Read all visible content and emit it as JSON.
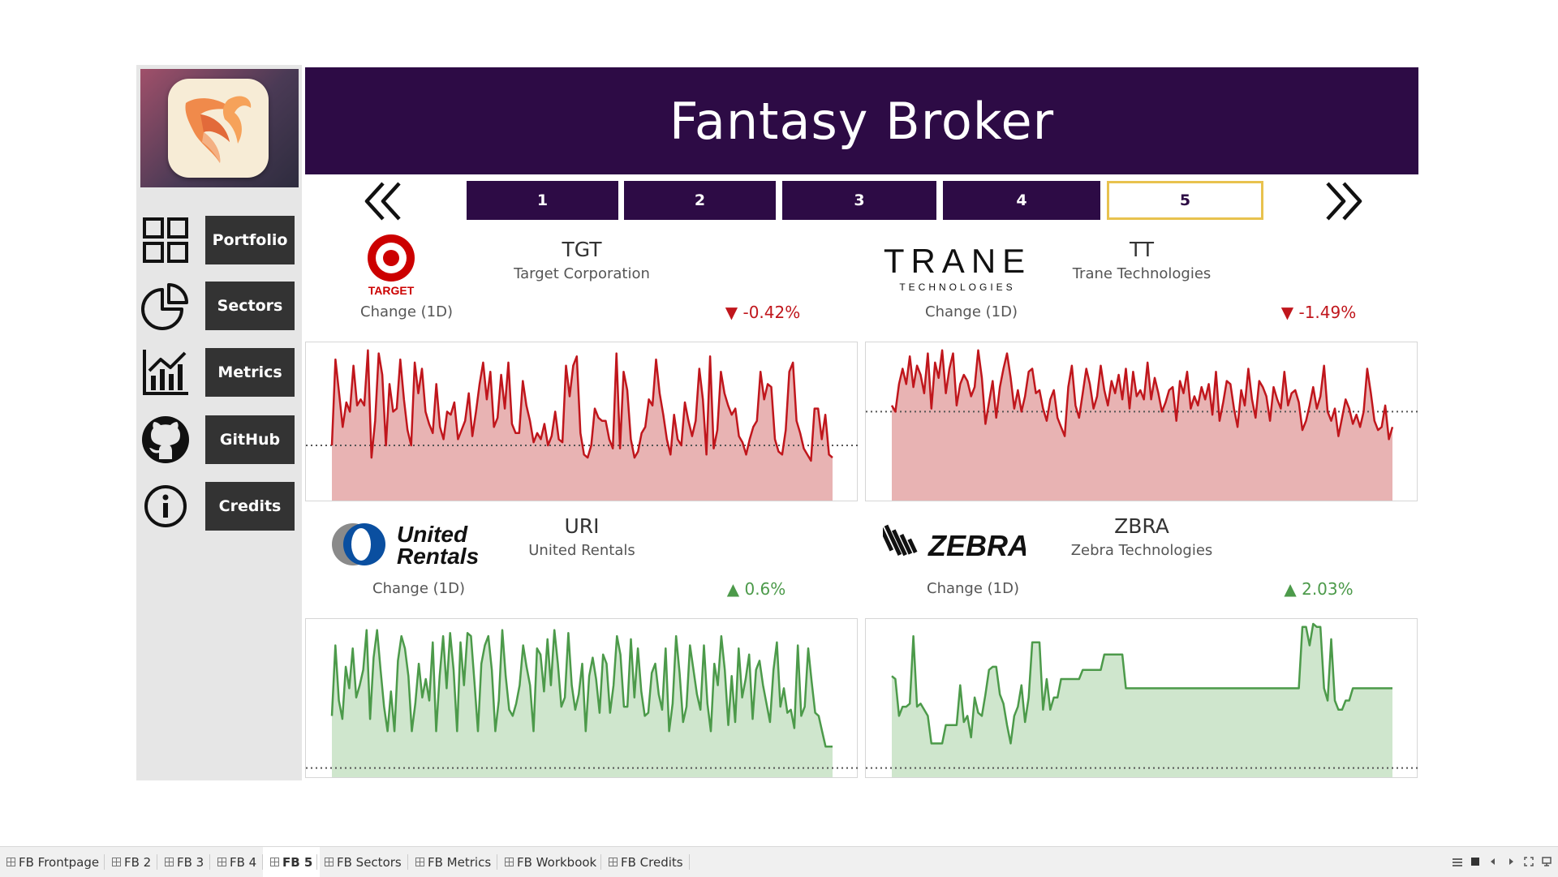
{
  "app": {
    "title": "Fantasy Broker"
  },
  "sidebar": {
    "items": [
      {
        "label": "Portfolio",
        "icon": "grid-icon"
      },
      {
        "label": "Sectors",
        "icon": "pie-chart-icon"
      },
      {
        "label": "Metrics",
        "icon": "bar-chart-icon"
      },
      {
        "label": "GitHub",
        "icon": "github-icon"
      },
      {
        "label": "Credits",
        "icon": "info-icon"
      }
    ]
  },
  "pagination": {
    "pages": [
      "1",
      "2",
      "3",
      "4",
      "5"
    ],
    "active": "5",
    "prev_icon": "double-chevron-left-icon",
    "next_icon": "double-chevron-right-icon"
  },
  "stocks": [
    {
      "ticker": "TGT",
      "company": "Target Corporation",
      "change_label": "Change (1D)",
      "change": "-0.42%",
      "direction": "down",
      "arrow": "▼",
      "logo_text": "TARGET",
      "chart_data": {
        "type": "area",
        "color": "#c0161c",
        "fill": "#e8b3b3",
        "baseline": 36,
        "values": [
          36,
          92,
          70,
          48,
          64,
          58,
          88,
          62,
          66,
          62,
          98,
          28,
          52,
          96,
          82,
          36,
          76,
          58,
          60,
          92,
          66,
          46,
          36,
          90,
          70,
          86,
          58,
          50,
          44,
          76,
          48,
          40,
          58,
          56,
          64,
          40,
          46,
          52,
          70,
          42,
          58,
          76,
          90,
          66,
          84,
          48,
          54,
          82,
          60,
          90,
          50,
          44,
          44,
          78,
          62,
          52,
          38,
          44,
          40,
          50,
          36,
          42,
          58,
          40,
          38,
          88,
          68,
          88,
          94,
          44,
          30,
          28,
          36,
          60,
          54,
          52,
          52,
          40,
          34,
          96,
          34,
          84,
          72,
          40,
          28,
          32,
          44,
          48,
          66,
          62,
          92,
          70,
          56,
          40,
          30,
          56,
          40,
          36,
          64,
          52,
          42,
          52,
          86,
          66,
          30,
          94,
          34,
          46,
          84,
          70,
          62,
          56,
          60,
          42,
          38,
          30,
          40,
          48,
          52,
          84,
          66,
          76,
          74,
          40,
          32,
          30,
          46,
          84,
          90,
          52,
          44,
          34,
          30,
          26,
          60,
          60,
          40,
          56,
          30,
          28
        ]
      }
    },
    {
      "ticker": "TT",
      "company": "Trane Technologies",
      "change_label": "Change (1D)",
      "change": "-1.49%",
      "direction": "down",
      "arrow": "▼",
      "logo_text": "TRANE",
      "logo_sub": "TECHNOLOGIES",
      "chart_data": {
        "type": "area",
        "color": "#c0161c",
        "fill": "#e8b3b3",
        "baseline": 58,
        "values": [
          62,
          58,
          76,
          86,
          76,
          94,
          74,
          88,
          82,
          70,
          96,
          60,
          90,
          80,
          98,
          70,
          86,
          96,
          62,
          76,
          82,
          78,
          68,
          74,
          98,
          80,
          50,
          64,
          78,
          54,
          74,
          86,
          96,
          80,
          60,
          72,
          58,
          68,
          84,
          86,
          70,
          72,
          60,
          52,
          66,
          72,
          54,
          48,
          42,
          74,
          88,
          62,
          54,
          70,
          86,
          76,
          60,
          68,
          88,
          72,
          62,
          78,
          70,
          82,
          66,
          86,
          60,
          84,
          68,
          72,
          66,
          90,
          66,
          80,
          70,
          58,
          64,
          72,
          74,
          52,
          78,
          70,
          84,
          60,
          68,
          62,
          74,
          66,
          76,
          56,
          84,
          52,
          64,
          78,
          76,
          60,
          48,
          72,
          62,
          86,
          66,
          54,
          78,
          74,
          68,
          52,
          74,
          66,
          60,
          84,
          62,
          70,
          72,
          64,
          46,
          52,
          62,
          74,
          60,
          68,
          88,
          58,
          52,
          60,
          42,
          54,
          66,
          60,
          50,
          56,
          48,
          58,
          86,
          70,
          52,
          46,
          48,
          62,
          40,
          48
        ]
      }
    },
    {
      "ticker": "URI",
      "company": "United Rentals",
      "change_label": "Change (1D)",
      "change": "0.6%",
      "direction": "up",
      "arrow": "▲",
      "logo_text": "United Rentals",
      "chart_data": {
        "type": "area",
        "color": "#4c9a4a",
        "fill": "#cfe6cd",
        "baseline": 6,
        "values": [
          40,
          86,
          50,
          38,
          72,
          58,
          84,
          52,
          60,
          70,
          96,
          38,
          78,
          96,
          70,
          46,
          30,
          56,
          30,
          76,
          92,
          84,
          66,
          30,
          48,
          74,
          52,
          64,
          50,
          88,
          30,
          66,
          92,
          58,
          94,
          70,
          30,
          88,
          60,
          94,
          92,
          62,
          30,
          74,
          86,
          92,
          70,
          30,
          50,
          96,
          66,
          44,
          40,
          48,
          60,
          86,
          72,
          60,
          30,
          84,
          80,
          56,
          90,
          60,
          96,
          74,
          46,
          52,
          94,
          60,
          44,
          54,
          74,
          30,
          66,
          78,
          64,
          42,
          80,
          74,
          42,
          60,
          92,
          80,
          46,
          46,
          90,
          52,
          84,
          56,
          40,
          42,
          68,
          74,
          54,
          44,
          84,
          30,
          48,
          92,
          68,
          36,
          46,
          86,
          70,
          54,
          44,
          86,
          48,
          30,
          74,
          60,
          92,
          70,
          34,
          66,
          36,
          84,
          52,
          64,
          80,
          38,
          70,
          76,
          60,
          48,
          36,
          70,
          88,
          46,
          58,
          42,
          44,
          32,
          86,
          40,
          46,
          84,
          62,
          42,
          40,
          30,
          20,
          20,
          20
        ]
      }
    },
    {
      "ticker": "ZBRA",
      "company": "Zebra Technologies",
      "change_label": "Change (1D)",
      "change": "2.03%",
      "direction": "up",
      "arrow": "▲",
      "logo_text": "ZEBRA",
      "chart_data": {
        "type": "area",
        "color": "#4c9a4a",
        "fill": "#cfe6cd",
        "baseline": 6,
        "values": [
          66,
          64,
          40,
          46,
          46,
          48,
          92,
          46,
          48,
          44,
          40,
          22,
          22,
          22,
          22,
          34,
          34,
          34,
          34,
          60,
          36,
          40,
          26,
          52,
          42,
          40,
          54,
          70,
          72,
          72,
          54,
          48,
          34,
          22,
          40,
          46,
          60,
          36,
          52,
          88,
          88,
          88,
          44,
          64,
          44,
          52,
          52,
          64,
          64,
          64,
          64,
          64,
          64,
          70,
          70,
          70,
          70,
          70,
          70,
          80,
          80,
          80,
          80,
          80,
          80,
          58,
          58,
          58,
          58,
          58,
          58,
          58,
          58,
          58,
          58,
          58,
          58,
          58,
          58,
          58,
          58,
          58,
          58,
          58,
          58,
          58,
          58,
          58,
          58,
          58,
          58,
          58,
          58,
          58,
          58,
          58,
          58,
          58,
          58,
          58,
          58,
          58,
          58,
          58,
          58,
          58,
          58,
          58,
          58,
          58,
          58,
          58,
          58,
          58,
          98,
          98,
          86,
          100,
          98,
          98,
          58,
          50,
          90,
          50,
          44,
          44,
          50,
          50,
          58,
          58,
          58,
          58,
          58,
          58,
          58,
          58,
          58,
          58,
          58,
          58
        ]
      }
    }
  ],
  "tabs": [
    {
      "label": "FB Frontpage",
      "active": false
    },
    {
      "label": "FB 2",
      "active": false
    },
    {
      "label": "FB 3",
      "active": false
    },
    {
      "label": "FB 4",
      "active": false
    },
    {
      "label": "FB 5",
      "active": true
    },
    {
      "label": "FB Sectors",
      "active": false
    },
    {
      "label": "FB Metrics",
      "active": false
    },
    {
      "label": "FB Workbook",
      "active": false
    },
    {
      "label": "FB Credits",
      "active": false
    }
  ],
  "statusbar_icons": [
    "grid-view-icon",
    "stop-icon",
    "prev-icon",
    "next-icon",
    "fullscreen-icon",
    "present-icon"
  ]
}
